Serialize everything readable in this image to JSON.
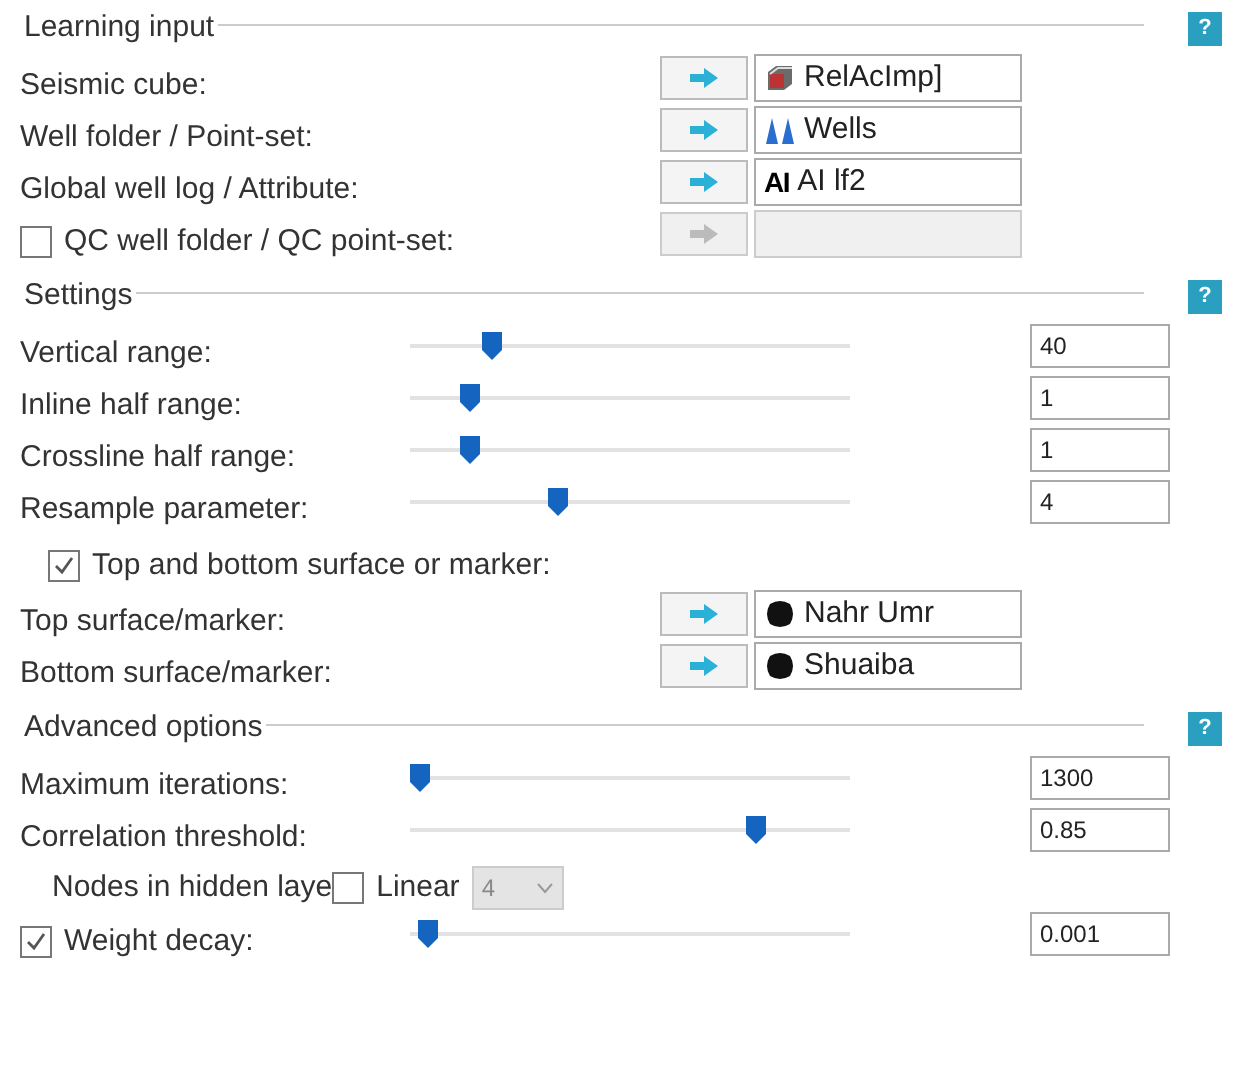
{
  "sections": [
    {
      "title": "Learning input",
      "help": "?",
      "rows": [
        {
          "kind": "picker",
          "label": "Seismic cube:",
          "disabled": false,
          "value": {
            "kind": "cube",
            "text": "RelAcImp]"
          }
        },
        {
          "kind": "picker",
          "label": "Well folder / Point-set:",
          "disabled": false,
          "value": {
            "kind": "wells",
            "text": "Wells"
          }
        },
        {
          "kind": "picker",
          "label": "Global well log / Attribute:",
          "disabled": false,
          "value": {
            "kind": "log",
            "mark": "AI",
            "text": "AI lf2"
          }
        },
        {
          "kind": "picker",
          "label": "QC well folder / QC point-set:",
          "checked": false,
          "disabled": true
        }
      ]
    },
    {
      "title": "Settings",
      "help": "?",
      "rows": [
        {
          "kind": "slider",
          "label": "Vertical range:",
          "level": 0.17,
          "value": "40"
        },
        {
          "kind": "slider",
          "label": "Inline half range:",
          "level": 0.12,
          "value": "1"
        },
        {
          "kind": "slider",
          "label": "Crossline half range:",
          "level": 0.12,
          "value": "1"
        },
        {
          "kind": "slider",
          "label": "Resample parameter:",
          "level": 0.33,
          "value": "4"
        },
        {
          "kind": "checkbox",
          "label": "Top and bottom surface or marker:",
          "checked": true
        },
        {
          "kind": "picker",
          "label": "Top surface/marker:",
          "disabled": false,
          "value": {
            "kind": "surface",
            "text": "Nahr Umr"
          }
        },
        {
          "kind": "picker",
          "label": "Bottom surface/marker:",
          "disabled": false,
          "value": {
            "kind": "surface",
            "text": "Shuaiba"
          }
        }
      ]
    },
    {
      "title": "Advanced options",
      "help": "?",
      "rows": [
        {
          "kind": "slider",
          "label": "Maximum iterations:",
          "level": 0.0,
          "value": "1300"
        },
        {
          "kind": "slider",
          "label": "Correlation threshold:",
          "level": 0.8,
          "value": "0.85"
        },
        {
          "kind": "nodes",
          "label": "Nodes in hidden laye",
          "option": {
            "label": "Linear",
            "checked": false
          },
          "select": {
            "value": "4",
            "disabled": true
          }
        },
        {
          "kind": "slider",
          "label": "Weight decay:",
          "checked": true,
          "level": 0.02,
          "value": "0.001"
        }
      ]
    }
  ]
}
